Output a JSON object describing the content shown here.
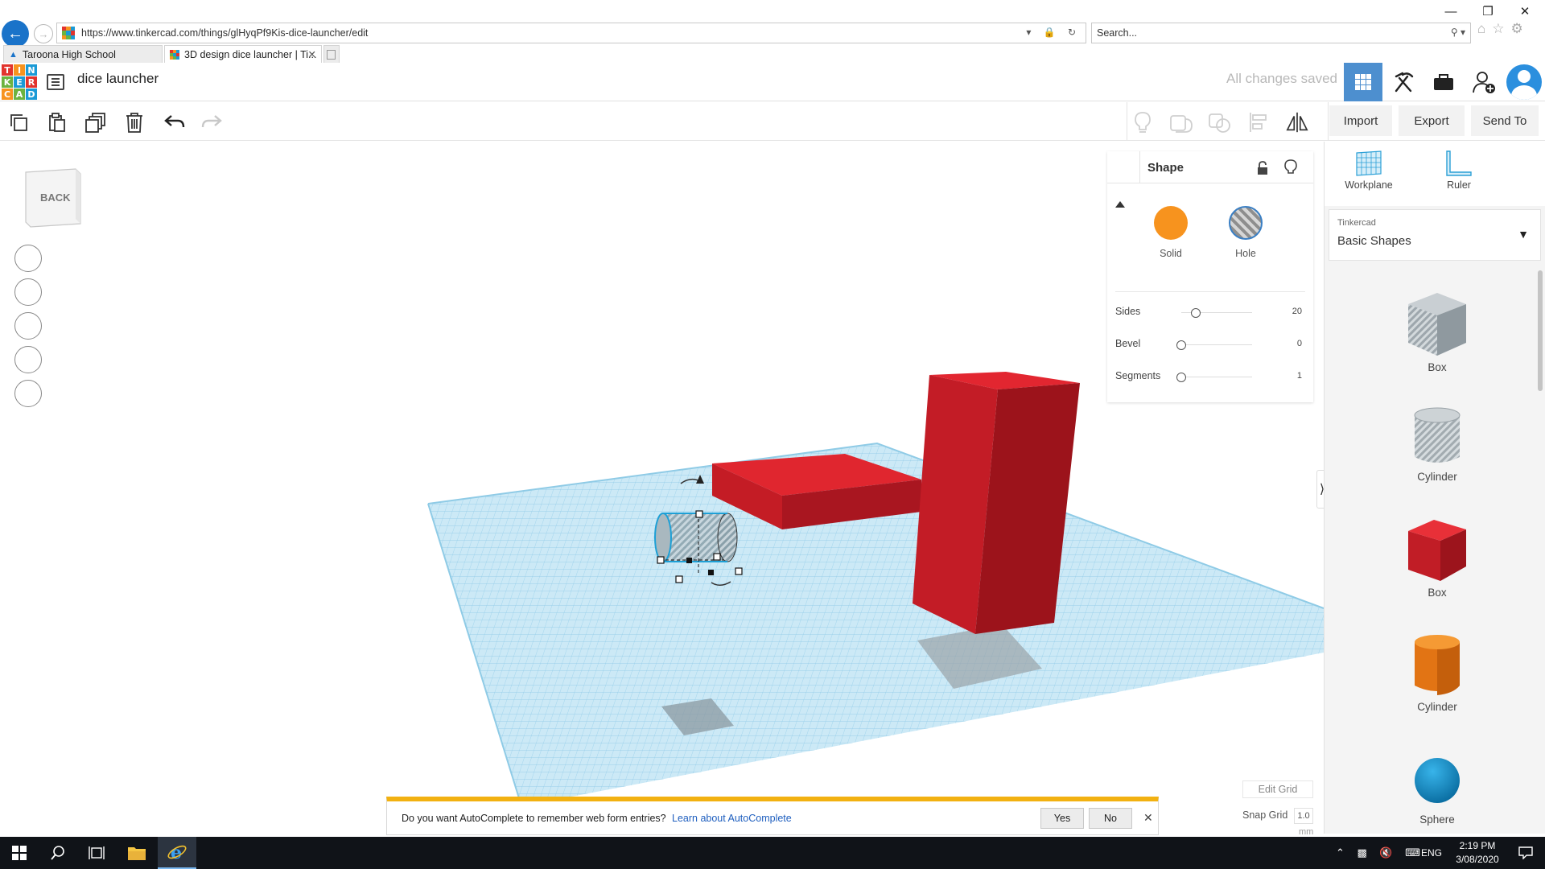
{
  "browser": {
    "url": "https://www.tinkercad.com/things/glHyqPf9Kis-dice-launcher/edit",
    "search_placeholder": "Search...",
    "tabs": [
      {
        "label": "Taroona High School",
        "active": false
      },
      {
        "label": "3D design dice launcher | Ti...",
        "active": true
      }
    ]
  },
  "header": {
    "logo_letters": [
      "T",
      "I",
      "N",
      "K",
      "E",
      "R",
      "C",
      "A",
      "D"
    ],
    "design_title": "dice launcher",
    "save_status": "All changes saved"
  },
  "toolbar": {
    "import_label": "Import",
    "export_label": "Export",
    "send_to_label": "Send To"
  },
  "viewcube": {
    "label": "BACK"
  },
  "inspector": {
    "title": "Shape",
    "solid_label": "Solid",
    "hole_label": "Hole",
    "solid_color": "#f7931e",
    "properties": [
      {
        "label": "Sides",
        "value": "20",
        "level": 0.2
      },
      {
        "label": "Bevel",
        "value": "0",
        "level": 0.0
      },
      {
        "label": "Segments",
        "value": "1",
        "level": 0.0
      }
    ]
  },
  "right_panel": {
    "workplane_label": "Workplane",
    "ruler_label": "Ruler",
    "library_category": "Tinkercad",
    "library_name": "Basic Shapes",
    "shapes": [
      {
        "label": "Box",
        "kind": "box-hole"
      },
      {
        "label": "Cylinder",
        "kind": "cylinder-hole"
      },
      {
        "label": "Box",
        "kind": "box-red"
      },
      {
        "label": "Cylinder",
        "kind": "cylinder-orange"
      },
      {
        "label": "Sphere",
        "kind": "sphere-blue"
      }
    ]
  },
  "grid": {
    "edit_grid_label": "Edit Grid",
    "snap_label": "Snap Grid",
    "snap_value": "1.0",
    "snap_unit": "mm"
  },
  "notification": {
    "message": "Do you want AutoComplete to remember web form entries?",
    "link": "Learn about AutoComplete",
    "yes_label": "Yes",
    "no_label": "No"
  },
  "taskbar": {
    "lang": "ENG",
    "time": "2:19 PM",
    "date": "3/08/2020"
  },
  "colors": {
    "accent_blue": "#1a73c9",
    "grid_blue": "#a9d8ee",
    "shape_red": "#d61f2b",
    "notif_yellow": "#f2b111"
  }
}
